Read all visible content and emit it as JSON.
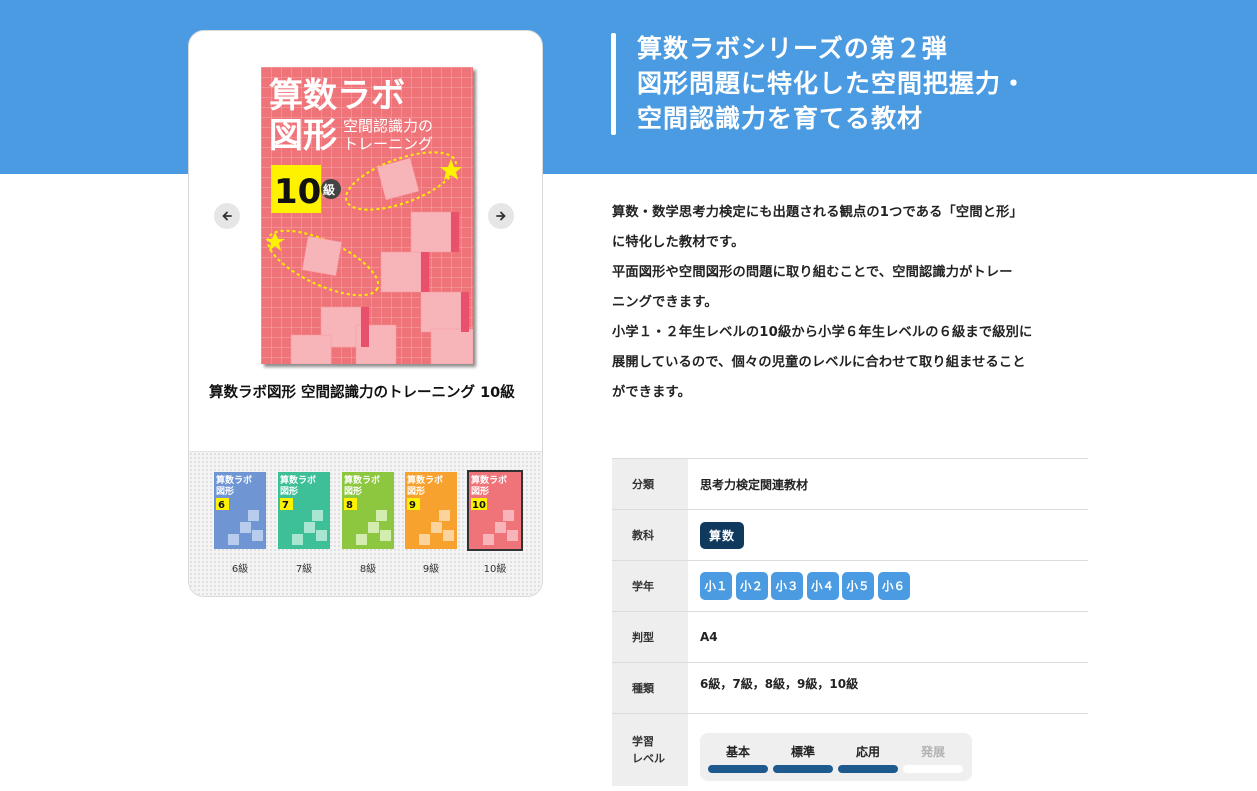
{
  "product": {
    "title": "算数ラボ図形 空間認識力のトレーニング 10級",
    "cover": {
      "brand": "算数ラボ",
      "kind": "図形",
      "subtitle1": "空間認識力の",
      "subtitle2": "トレーニング",
      "level_number": "10",
      "level_suffix": "級"
    },
    "thumbnails": [
      {
        "label": "6級",
        "number": "6",
        "color": "#6f95d3"
      },
      {
        "label": "7級",
        "number": "7",
        "color": "#3dbf97"
      },
      {
        "label": "8級",
        "number": "8",
        "color": "#8dc63f"
      },
      {
        "label": "9級",
        "number": "9",
        "color": "#f7a12e"
      },
      {
        "label": "10級",
        "number": "10",
        "color": "#ef7479"
      }
    ]
  },
  "headline": {
    "line1": "算数ラボシリーズの第２弾",
    "line2": "図形問題に特化した空間把握力・",
    "line3": "空間認識力を育てる教材"
  },
  "description": {
    "line1": "算数・数学思考力検定にも出題される観点の1つである「空間と形」",
    "line2": "に特化した教材です。",
    "line3": "平面図形や空間図形の問題に取り組むことで、空間認識力がトレー",
    "line4": "ニングできます。",
    "line5": "小学１・２年生レベルの10級から小学６年生レベルの６級まで級別に",
    "line6": "展開しているので、個々の児童のレベルに合わせて取り組ませること",
    "line7": "ができます。"
  },
  "spec": {
    "category_label": "分類",
    "category_value": "思考力検定関連教材",
    "subject_label": "教科",
    "subject_value": "算数",
    "grade_label": "学年",
    "grades": [
      "小１",
      "小２",
      "小３",
      "小４",
      "小５",
      "小６"
    ],
    "size_label": "判型",
    "size_value": "A4",
    "types_label": "種類",
    "types_value": "6級，7級，8級，9級，10級",
    "level_label_1": "学習",
    "level_label_2": "レベル",
    "levels": [
      {
        "name": "基本",
        "active": true
      },
      {
        "name": "標準",
        "active": true
      },
      {
        "name": "応用",
        "active": true
      },
      {
        "name": "発展",
        "active": false
      }
    ]
  },
  "colors": {
    "accent": "#4a9be2",
    "navy": "#0f3a5e",
    "level_bar": "#1e5a8e",
    "cover_pink": "#ef7479"
  }
}
